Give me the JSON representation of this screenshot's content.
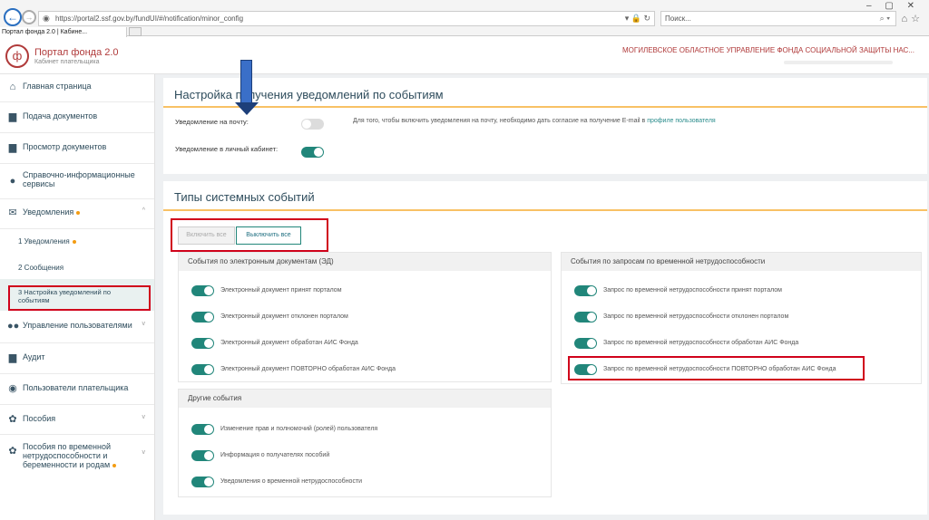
{
  "browser": {
    "url": "https://portal2.ssf.gov.by/fundUI/#/notification/minor_config",
    "search_placeholder": "Поиск...",
    "tab_title": "Портал фонда 2.0 | Кабине...",
    "window_controls": "– ▢ ✕"
  },
  "header": {
    "title": "Портал фонда 2.0",
    "subtitle": "Кабинет плательщика",
    "org": "МОГИЛЕВСКОЕ ОБЛАСТНОЕ УПРАВЛЕНИЕ ФОНДА СОЦИАЛЬНОЙ ЗАЩИТЫ НАС..."
  },
  "sidebar": {
    "items": [
      {
        "label": "Главная страница",
        "icon": "home-icon"
      },
      {
        "label": "Подача документов",
        "icon": "document-icon"
      },
      {
        "label": "Просмотр документов",
        "icon": "document-view-icon"
      },
      {
        "label": "Справочно-информационные сервисы",
        "icon": "info-icon"
      },
      {
        "label": "Уведомления",
        "icon": "mail-icon"
      },
      {
        "label": "Управление пользователями",
        "icon": "users-icon"
      },
      {
        "label": "Аудит",
        "icon": "audit-icon"
      },
      {
        "label": "Пользователи плательщика",
        "icon": "user-icon"
      },
      {
        "label": "Пособия",
        "icon": "benefits-icon"
      },
      {
        "label": "Пособия по временной нетрудоспособности и беременности и родам",
        "icon": "benefits-icon"
      }
    ],
    "sub": [
      "1 Уведомления",
      "2 Сообщения",
      "3 Настройка уведомлений по событиям"
    ]
  },
  "settings": {
    "title": "Настройка получения уведомлений по событиям",
    "email_label": "Уведомление на почту:",
    "email_hint": "Для того, чтобы включить уведомления на почту, необходимо дать согласие на получение E-mail в",
    "email_hint_link": "профиле пользователя",
    "cabinet_label": "Уведомление в личный кабинет:"
  },
  "events": {
    "title": "Типы системных событий",
    "enable_all": "Включить все",
    "disable_all": "Выключить все",
    "ed_group": {
      "title": "События по электронным документам (ЭД)",
      "items": [
        "Электронный документ принят порталом",
        "Электронный документ отклонен порталом",
        "Электронный документ обработан АИС Фонда",
        "Электронный документ ПОВТОРНО обработан АИС Фонда"
      ]
    },
    "other_group": {
      "title": "Другие события",
      "items": [
        "Изменение прав и полномочий (ролей) пользователя",
        "Информация о получателях пособий",
        "Уведомления о временной нетрудоспособности"
      ]
    },
    "sick_group": {
      "title": "События по запросам по временной нетрудоспособности",
      "items": [
        "Запрос по временной нетрудоспособности принят порталом",
        "Запрос по временной нетрудоспособности отклонен порталом",
        "Запрос по временной нетрудоспособности обработан АИС Фонда",
        "Запрос по временной нетрудоспособности ПОВТОРНО обработан АИС Фонда"
      ]
    }
  },
  "colors": {
    "accent": "#21867a",
    "brand": "#b03a3a",
    "highlight": "#d0021b",
    "underline": "#f5a623"
  }
}
